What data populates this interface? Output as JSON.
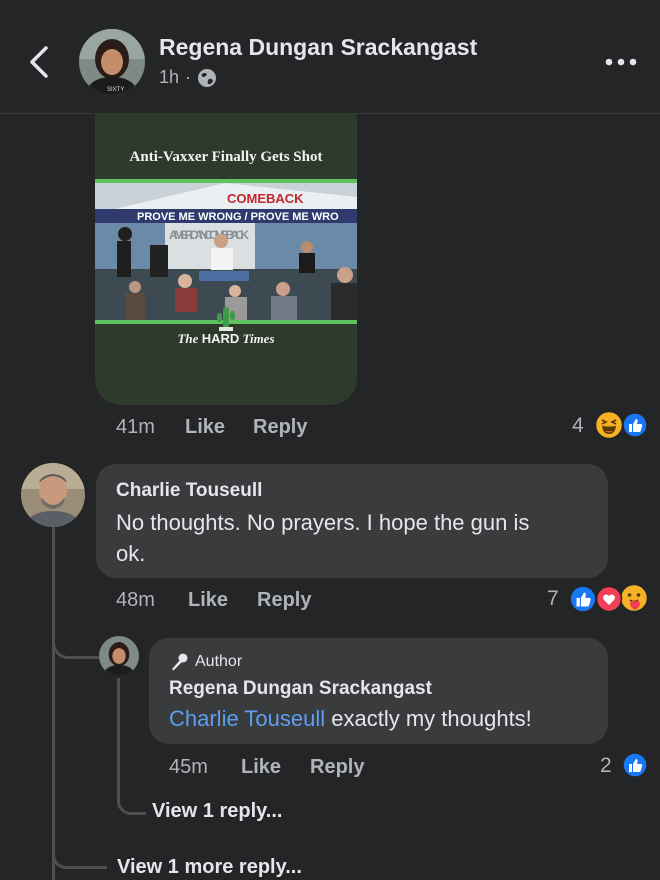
{
  "header": {
    "poster_name": "Regena Dungan Srackangast",
    "time": "1h",
    "separator": "·",
    "privacy_icon": "globe-icon",
    "more_icon": "more-dots-icon",
    "back_icon": "chevron-left-icon"
  },
  "meme": {
    "title": "Anti-Vaxxer Finally Gets Shot",
    "banner_top": "COMEBACK",
    "banner_text": "PROVE ME WRONG / PROVE ME WRO",
    "sign_text": "AMERICAN COMEBACK",
    "logo_prefix": "The",
    "logo_bold": "HARD",
    "logo_suffix": "Times"
  },
  "first_actions": {
    "time": "41m",
    "like": "Like",
    "reply": "Reply",
    "reaction_count": "4",
    "reactions": [
      "haha-icon",
      "like-icon"
    ]
  },
  "comment": {
    "author": "Charlie Touseull",
    "text_line1": "No thoughts. No prayers. I hope the gun is",
    "text_line2": "ok.",
    "time": "48m",
    "like": "Like",
    "reply": "Reply",
    "reaction_count": "7",
    "reactions": [
      "like-icon",
      "love-icon",
      "care-icon"
    ]
  },
  "reply": {
    "badge": "Author",
    "author": "Regena Dungan Srackangast",
    "mention": "Charlie Touseull",
    "text": " exactly my thoughts!",
    "time": "45m",
    "like": "Like",
    "reply": "Reply",
    "reaction_count": "2",
    "reactions": [
      "like-icon"
    ]
  },
  "view_1_reply": "View 1 reply...",
  "view_more_reply": "View 1 more reply...",
  "colors": {
    "background": "#242526",
    "bubble": "#3a3b3c",
    "mention": "#5d9ef2",
    "like_blue": "#1877f2",
    "love_red": "#f33e58",
    "haha_yellow": "#f7b125"
  }
}
